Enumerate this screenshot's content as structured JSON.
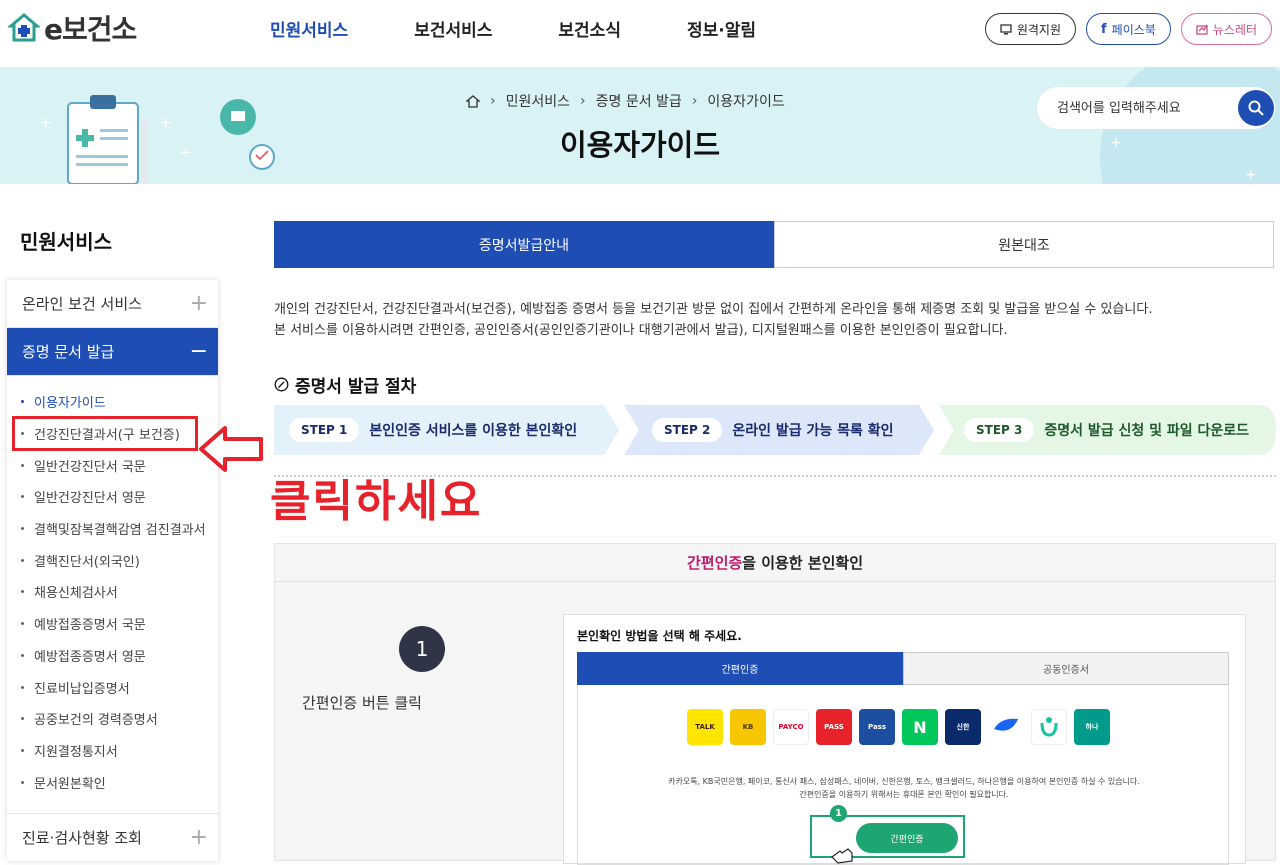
{
  "header": {
    "logo_text": "e보건소",
    "nav": [
      "민원서비스",
      "보건서비스",
      "보건소식",
      "정보·알림"
    ],
    "active_nav": "민원서비스",
    "buttons": {
      "remote": "원격지원",
      "facebook": "페이스북",
      "newsletter": "뉴스레터"
    }
  },
  "banner": {
    "breadcrumb": [
      "민원서비스",
      "증명 문서 발급",
      "이용자가이드"
    ],
    "title": "이용자가이드",
    "search_placeholder": "검색어를 입력해주세요"
  },
  "sidebar": {
    "title": "민원서비스",
    "sections": {
      "online": "온라인 보건 서비스",
      "docs": "증명 문서 발급",
      "checkup": "진료·검사현황 조회"
    },
    "items": [
      "이용자가이드",
      "건강진단결과서(구 보건증)",
      "일반건강진단서 국문",
      "일반건강진단서 영문",
      "결핵및잠복결핵감염 검진결과서",
      "결핵진단서(외국인)",
      "채용신체검사서",
      "예방접종증명서 국문",
      "예방접종증명서 영문",
      "진료비납입증명서",
      "공중보건의 경력증명서",
      "지원결정통지서",
      "문서원본확인"
    ]
  },
  "annotation": {
    "text": "클릭하세요"
  },
  "main": {
    "tabs": [
      "증명서발급안내",
      "원본대조"
    ],
    "desc_line1": "개인의 건강진단서, 건강진단결과서(보건증), 예방접종 증명서 등을 보건기관 방문 없이 집에서 간편하게 온라인을 통해 제증명 조회 및 발급을 받으실 수 있습니다.",
    "desc_line2": "본 서비스를 이용하시려면 간편인증, 공인인증서(공인인증기관이나 대행기관에서 발급), 디지털원패스를 이용한 본인인증이 필요합니다.",
    "process_title": "증명서 발급 절차",
    "steps": [
      {
        "label": "STEP 1",
        "text": "본인인증 서비스를 이용한 본인확인"
      },
      {
        "label": "STEP 2",
        "text": "온라인 발급 가능 목록 확인"
      },
      {
        "label": "STEP 3",
        "text": "증명서 발급 신청 및 파일 다운로드"
      }
    ],
    "guide": {
      "head_hl": "간편인증",
      "head_rest": "을 이용한 본인확인",
      "step_num": "1",
      "step_desc": "간편인증 버튼 클릭",
      "mock_title": "본인확인 방법을 선택 해 주세요.",
      "mock_tabs": [
        "간편인증",
        "공동인증서"
      ],
      "providers": [
        "TALK",
        "KB",
        "PAYCO",
        "PASS",
        "Pass",
        "N",
        "신한",
        "토스",
        "",
        "하나"
      ],
      "note1": "카카오톡, KB국민은행, 페이코, 통신사 패스, 삼성패스, 네이버, 신한은행, 토스, 뱅크샐러드, 하나은행을 이용하여 본인인증 하실 수 있습니다.",
      "note2": "간편인증을 이용하기 위해서는 휴대폰 본인 확인이 필요합니다.",
      "btn": "간편인증",
      "badge": "1"
    }
  }
}
